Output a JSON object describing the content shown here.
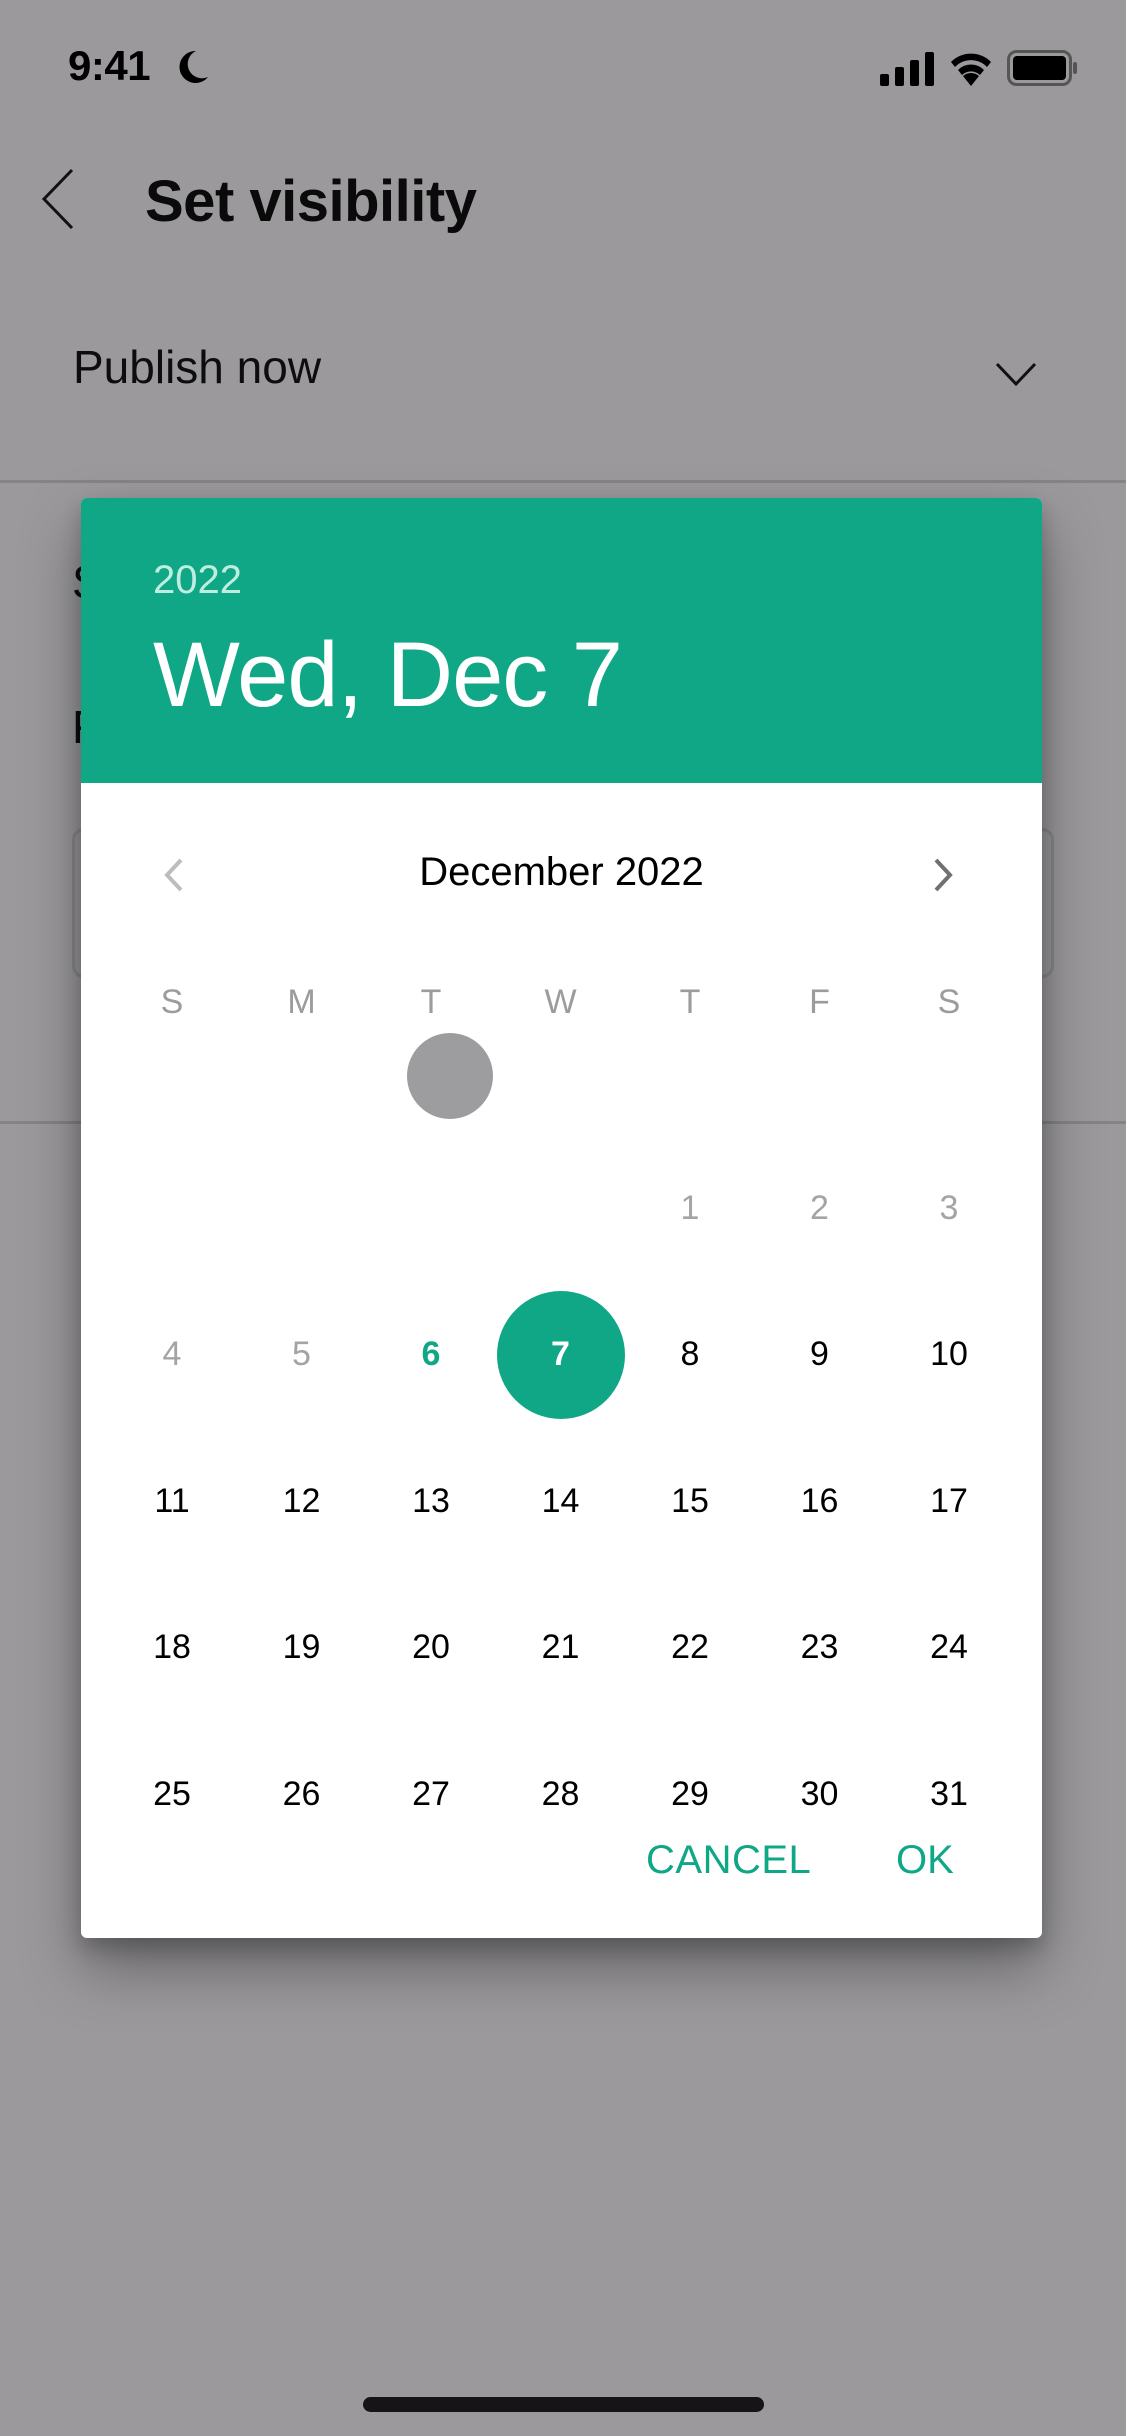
{
  "status_bar": {
    "time": "9:41",
    "icons": [
      "moon-icon",
      "signal-icon",
      "wifi-icon",
      "battery-icon"
    ]
  },
  "header": {
    "back_icon": "chevron-left-icon",
    "title": "Set visibility"
  },
  "publish_select": {
    "value": "Publish now",
    "icon": "chevron-down-icon"
  },
  "background_labels": {
    "partial_1": "S",
    "partial_2": "F"
  },
  "date_picker": {
    "header_year": "2022",
    "header_date": "Wed, Dec 7",
    "month_label": "December 2022",
    "prev_icon": "chevron-left-icon",
    "next_icon": "chevron-right-icon",
    "weekdays": [
      "S",
      "M",
      "T",
      "W",
      "T",
      "F",
      "S"
    ],
    "first_weekday_index": 4,
    "days_in_month": 31,
    "disabled_through": 5,
    "today": 6,
    "selected": 7,
    "cancel_label": "CANCEL",
    "ok_label": "OK",
    "accent_color": "#10a787"
  }
}
